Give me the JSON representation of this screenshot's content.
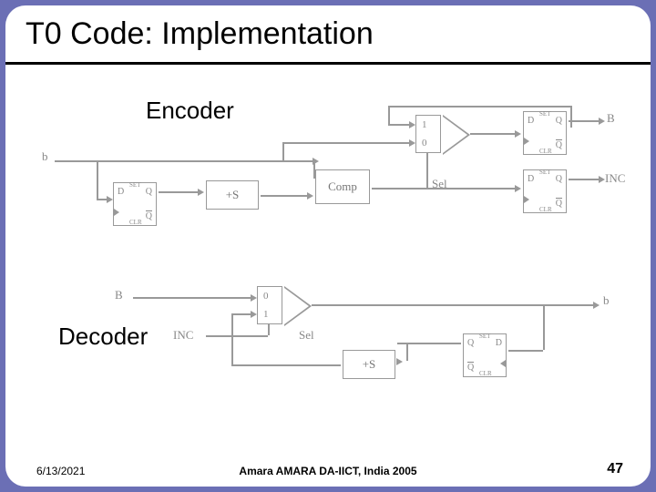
{
  "title": "T0 Code: Implementation",
  "sections": {
    "encoder_label": "Encoder",
    "decoder_label": "Decoder"
  },
  "encoder": {
    "input_b": "b",
    "adder": "+S",
    "comparator": "Comp",
    "mux_top": "1",
    "mux_bottom": "0",
    "sel": "Sel",
    "ff": {
      "D": "D",
      "Q": "Q",
      "Qbar": "Q",
      "SET": "SET",
      "CLR": "CLR"
    },
    "out_B": "B",
    "out_INC": "INC"
  },
  "decoder": {
    "in_B": "B",
    "in_INC": "INC",
    "mux_top": "0",
    "mux_bottom": "1",
    "sel": "Sel",
    "adder": "+S",
    "ff": {
      "D": "D",
      "Q": "Q",
      "Qbar": "Q",
      "SET": "SET",
      "CLR": "CLR"
    },
    "out_b": "b"
  },
  "footer": {
    "date": "6/13/2021",
    "center": "Amara AMARA DA-IICT, India 2005",
    "page": "47"
  }
}
